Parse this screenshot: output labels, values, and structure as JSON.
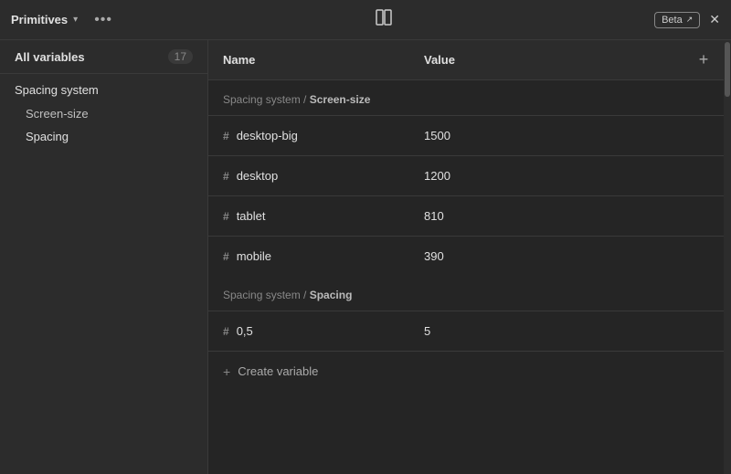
{
  "titleBar": {
    "title": "Primitives",
    "betaLabel": "Beta",
    "icons": {
      "chevron": "▾",
      "threeDots": "•••",
      "layout": "⬜",
      "close": "✕",
      "externalLink": "↗"
    }
  },
  "sidebar": {
    "allVariables": {
      "label": "All variables",
      "count": "17"
    },
    "groups": [
      {
        "label": "Spacing system",
        "items": [
          {
            "label": "Screen-size"
          },
          {
            "label": "Spacing"
          }
        ]
      }
    ]
  },
  "table": {
    "headers": {
      "name": "Name",
      "value": "Value"
    },
    "sections": [
      {
        "title": "Spacing system / ",
        "titleBold": "Screen-size",
        "rows": [
          {
            "name": "desktop-big",
            "value": "1500"
          },
          {
            "name": "desktop",
            "value": "1200"
          },
          {
            "name": "tablet",
            "value": "810"
          },
          {
            "name": "mobile",
            "value": "390"
          }
        ]
      },
      {
        "title": "Spacing system / ",
        "titleBold": "Spacing",
        "rows": [
          {
            "name": "0,5",
            "value": "5"
          }
        ]
      }
    ],
    "createVariable": "+ Create variable"
  }
}
